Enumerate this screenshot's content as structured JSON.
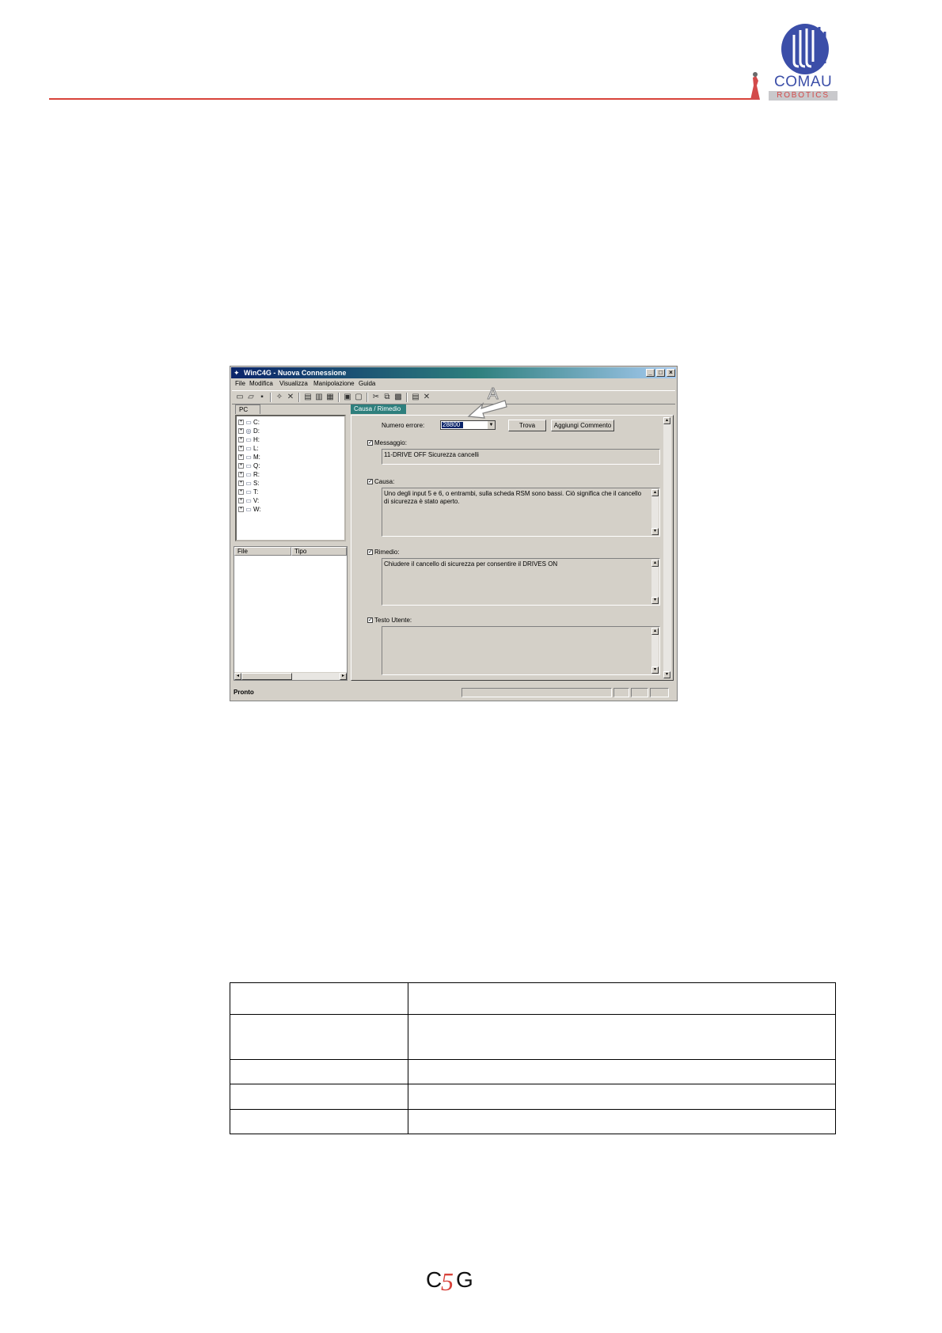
{
  "header": {
    "brand": "COMAU",
    "sub": "ROBOTICS",
    "colors": {
      "rule": "#d8423a",
      "brand_blue": "#3b4ea8",
      "brand_red": "#d34a4a"
    }
  },
  "window": {
    "title": "WinC4G - Nuova Connessione",
    "menu": [
      "File",
      "Modifica",
      "Visualizza",
      "Manipolazione",
      "Guida"
    ],
    "left_tab": "PC",
    "drives": [
      "C:",
      "D:",
      "H:",
      "L:",
      "M:",
      "Q:",
      "R:",
      "S:",
      "T:",
      "V:",
      "W:"
    ],
    "file_columns": [
      "File",
      "Tipo"
    ],
    "tab": "Causa / Rimedio",
    "error_label": "Numero errore:",
    "error_value": "28800",
    "find_button": "Trova",
    "comment_button": "Aggiungi Commento",
    "message_label": "Messaggio:",
    "message_text": "11-DRIVE OFF Sicurezza cancelli",
    "cause_label": "Causa:",
    "cause_text": "Uno degli input  5 e  6, o entrambi, sulla scheda RSM sono bassi. Ciò significa che il cancello di sicurezza è stato aperto.",
    "remedy_label": "Rimedio:",
    "remedy_text": "Chiudere il cancello di sicurezza per consentire il DRIVES ON",
    "user_text_label": "Testo Utente:",
    "status": "Pronto",
    "annotation": "A",
    "colors": {
      "face": "#d4d0c8",
      "title_start": "#0a246a",
      "title_mid": "#2e7f7d",
      "tab": "#2e7f7d"
    }
  },
  "footer": {
    "logo_left": "C",
    "logo_mid": "5",
    "logo_right": "G"
  }
}
